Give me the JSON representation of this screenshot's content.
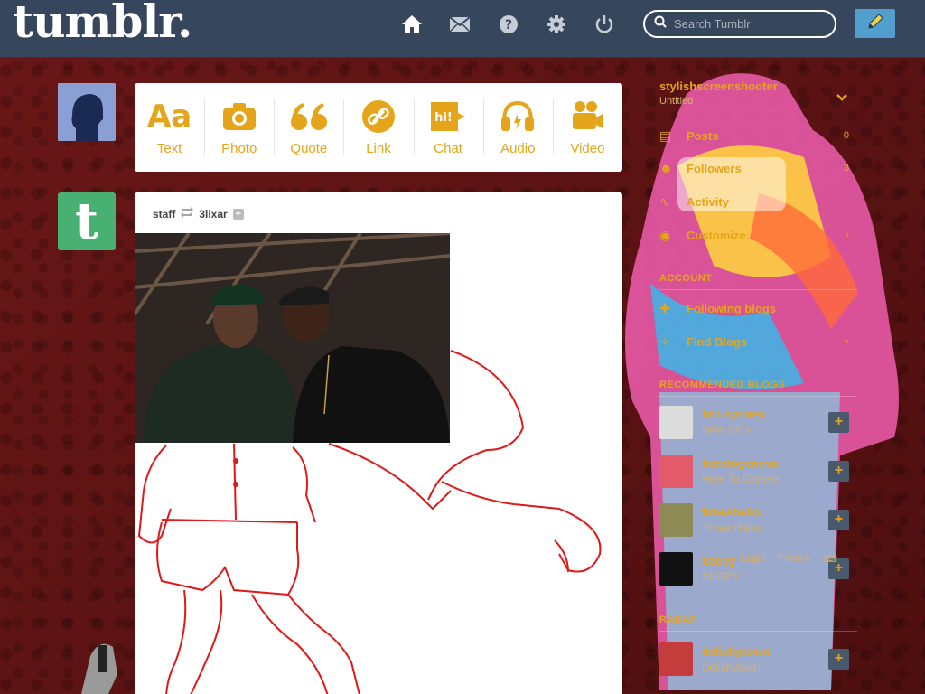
{
  "header": {
    "logo": "tumblr.",
    "search_placeholder": "Search Tumblr",
    "nav_icons": [
      "home-icon",
      "mail-icon",
      "help-icon",
      "settings-icon",
      "power-icon"
    ],
    "compose_icon": "pencil-icon"
  },
  "post_types": [
    {
      "label": "Text",
      "icon": "text-icon"
    },
    {
      "label": "Photo",
      "icon": "camera-icon"
    },
    {
      "label": "Quote",
      "icon": "quote-icon"
    },
    {
      "label": "Link",
      "icon": "link-icon"
    },
    {
      "label": "Chat",
      "icon": "chat-icon"
    },
    {
      "label": "Audio",
      "icon": "headphones-icon"
    },
    {
      "label": "Video",
      "icon": "video-camera-icon"
    }
  ],
  "post": {
    "author": "staff",
    "reblogged_from": "3lixar"
  },
  "sidebar": {
    "blog_name": "stylishscreenshooter",
    "blog_subtitle": "Untitled",
    "items": [
      {
        "label": "Posts",
        "count": "0",
        "icon": "posts-icon"
      },
      {
        "label": "Followers",
        "count": "3",
        "icon": "followers-icon"
      },
      {
        "label": "Activity",
        "count": "",
        "icon": "activity-icon"
      },
      {
        "label": "Customize",
        "count": "",
        "icon": "eye-icon"
      }
    ],
    "account_title": "ACCOUNT",
    "account_items": [
      {
        "label": "Following blogs",
        "icon": "add-person-icon"
      },
      {
        "label": "Find Blogs",
        "icon": "compass-icon"
      }
    ],
    "recommended_title": "RECOMMENDED BLOGS",
    "recommended": [
      {
        "name": "brb-sydney",
        "title": "BRB SYD",
        "color": "#dcdcdc"
      },
      {
        "name": "heretogeneva",
        "title": "Here To Geneva",
        "color": "#e35a6b"
      },
      {
        "name": "timeshaiku",
        "title": "Times Haiku",
        "color": "#8d8a55"
      },
      {
        "name": "xcopy",
        "title": "XCOPY",
        "color": "#111111"
      }
    ],
    "radar_title": "RADAR",
    "radar": [
      {
        "name": "delishytown",
        "title": "Delishytown",
        "color": "#c43c3c"
      }
    ],
    "footer_links": [
      "Legal",
      "Privacy"
    ]
  },
  "colors": {
    "header_bg": "#36465d",
    "accent": "#e4a51a",
    "compose_bg": "#529ecc",
    "page_bg": "#5b1313"
  }
}
